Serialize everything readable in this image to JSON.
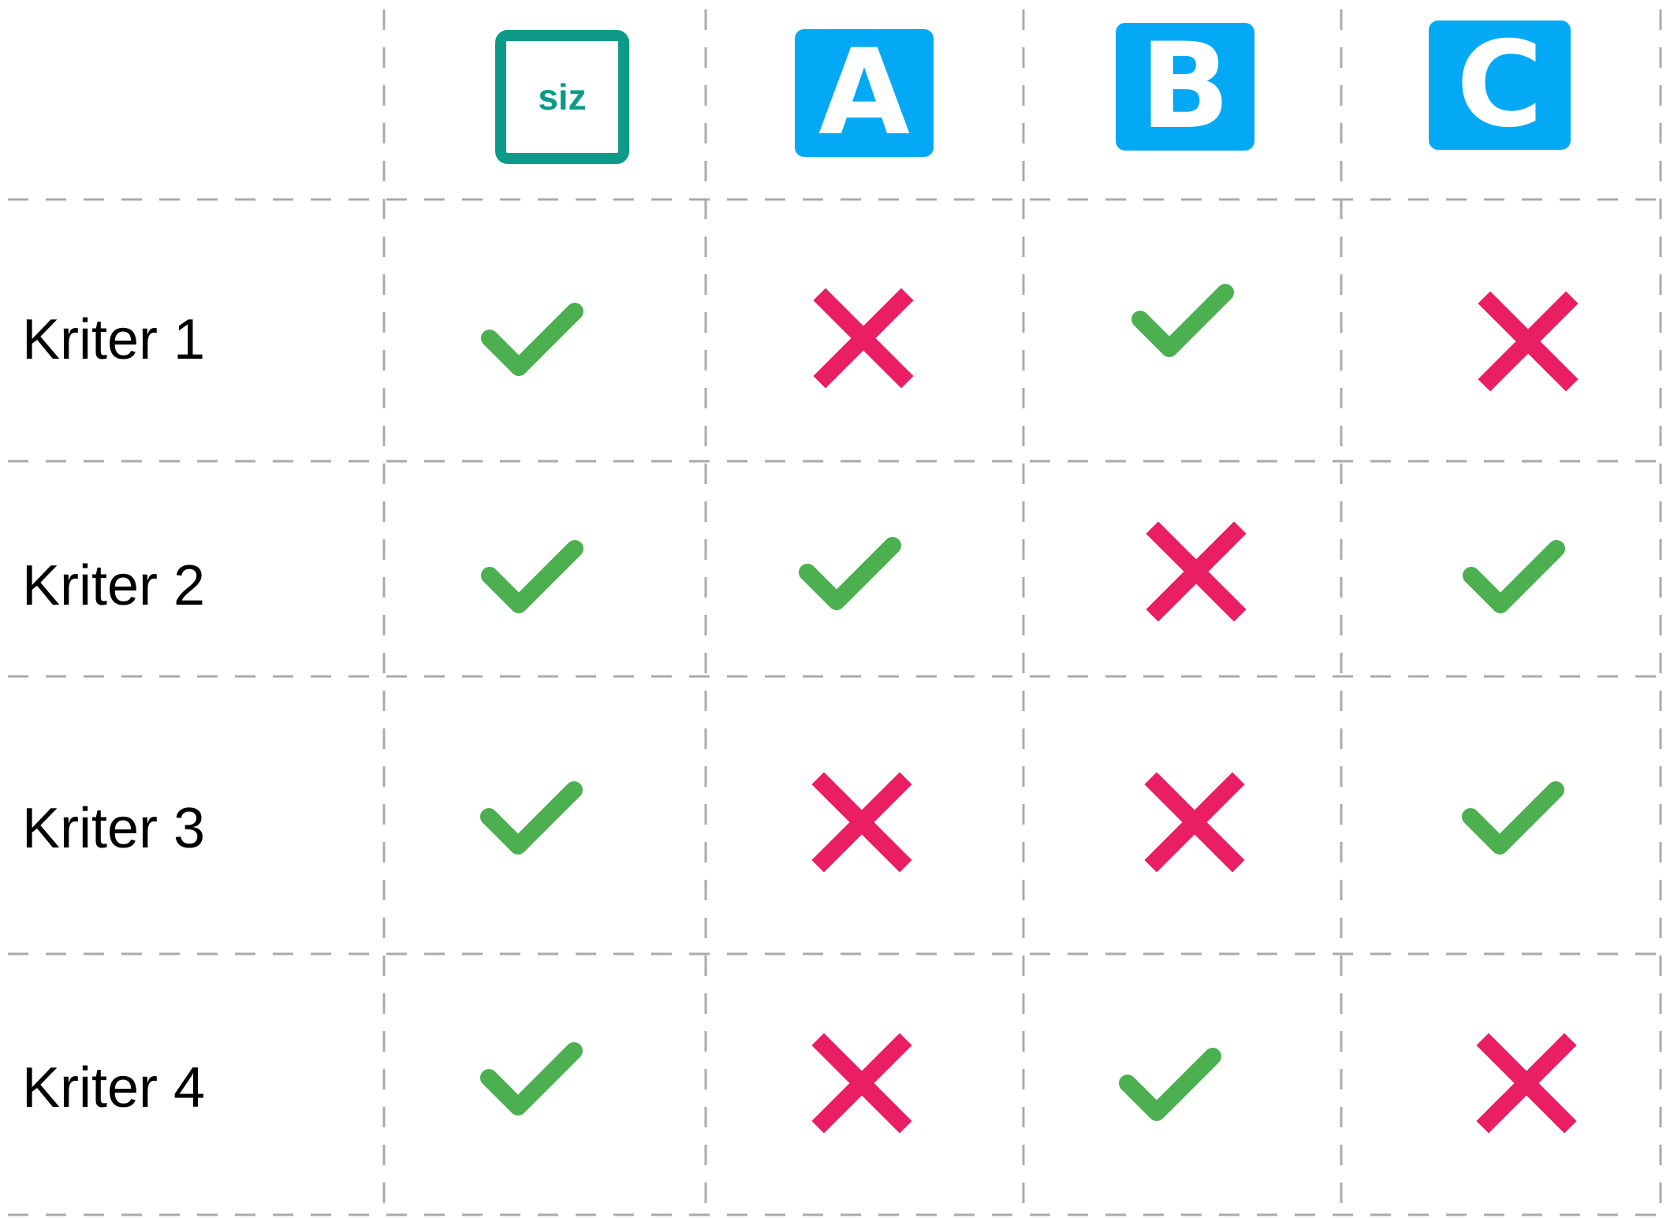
{
  "colors": {
    "grid_line": "#aaaaaa",
    "check": "#4caf50",
    "cross": "#e91e63",
    "siz_brand": "#0d9a88",
    "competitor_brand": "#03a9f4"
  },
  "columns": [
    {
      "label": "siz",
      "icon": "siz-logo-icon"
    },
    {
      "label": "A",
      "icon": "letter-a-icon"
    },
    {
      "label": "B",
      "icon": "letter-b-icon"
    },
    {
      "label": "C",
      "icon": "letter-c-icon"
    }
  ],
  "rows": [
    {
      "label": "Kriter 1",
      "marks": [
        "check",
        "cross",
        "check",
        "cross"
      ]
    },
    {
      "label": "Kriter 2",
      "marks": [
        "check",
        "check",
        "cross",
        "check"
      ]
    },
    {
      "label": "Kriter 3",
      "marks": [
        "check",
        "cross",
        "cross",
        "check"
      ]
    },
    {
      "label": "Kriter 4",
      "marks": [
        "check",
        "cross",
        "check",
        "cross"
      ]
    }
  ]
}
